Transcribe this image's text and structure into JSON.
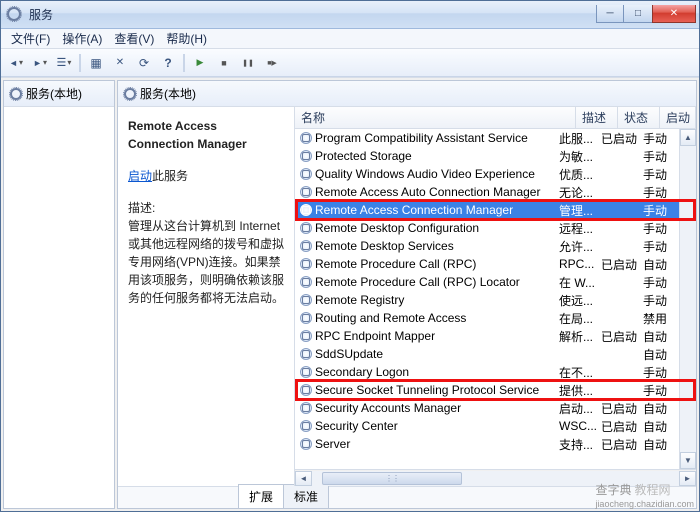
{
  "window": {
    "title": "服务"
  },
  "menu": {
    "file": "文件(F)",
    "action": "操作(A)",
    "view": "查看(V)",
    "help": "帮助(H)"
  },
  "left": {
    "header": "服务(本地)"
  },
  "right": {
    "header": "服务(本地)"
  },
  "detail": {
    "title": "Remote Access Connection Manager",
    "start_link": "启动",
    "start_suffix": "此服务",
    "desc_label": "描述:",
    "desc_text": "管理从这台计算机到 Internet 或其他远程网络的拨号和虚拟专用网络(VPN)连接。如果禁用该项服务，则明确依赖该服务的任何服务都将无法启动。"
  },
  "columns": {
    "name": "名称",
    "desc": "描述",
    "status": "状态",
    "startup": "启动"
  },
  "services": [
    {
      "name": "Program Compatibility Assistant Service",
      "desc": "此服...",
      "status": "已启动",
      "startup": "手动"
    },
    {
      "name": "Protected Storage",
      "desc": "为敏...",
      "status": "",
      "startup": "手动"
    },
    {
      "name": "Quality Windows Audio Video Experience",
      "desc": "优质...",
      "status": "",
      "startup": "手动"
    },
    {
      "name": "Remote Access Auto Connection Manager",
      "desc": "无论...",
      "status": "",
      "startup": "手动"
    },
    {
      "name": "Remote Access Connection Manager",
      "desc": "管理...",
      "status": "",
      "startup": "手动",
      "selected": true
    },
    {
      "name": "Remote Desktop Configuration",
      "desc": "远程...",
      "status": "",
      "startup": "手动"
    },
    {
      "name": "Remote Desktop Services",
      "desc": "允许...",
      "status": "",
      "startup": "手动"
    },
    {
      "name": "Remote Procedure Call (RPC)",
      "desc": "RPC...",
      "status": "已启动",
      "startup": "自动"
    },
    {
      "name": "Remote Procedure Call (RPC) Locator",
      "desc": "在 W...",
      "status": "",
      "startup": "手动"
    },
    {
      "name": "Remote Registry",
      "desc": "使远...",
      "status": "",
      "startup": "手动"
    },
    {
      "name": "Routing and Remote Access",
      "desc": "在局...",
      "status": "",
      "startup": "禁用"
    },
    {
      "name": "RPC Endpoint Mapper",
      "desc": "解析...",
      "status": "已启动",
      "startup": "自动"
    },
    {
      "name": "SddSUpdate",
      "desc": "",
      "status": "",
      "startup": "自动"
    },
    {
      "name": "Secondary Logon",
      "desc": "在不...",
      "status": "",
      "startup": "手动"
    },
    {
      "name": "Secure Socket Tunneling Protocol Service",
      "desc": "提供...",
      "status": "",
      "startup": "手动"
    },
    {
      "name": "Security Accounts Manager",
      "desc": "启动...",
      "status": "已启动",
      "startup": "自动"
    },
    {
      "name": "Security Center",
      "desc": "WSC...",
      "status": "已启动",
      "startup": "自动"
    },
    {
      "name": "Server",
      "desc": "支持...",
      "status": "已启动",
      "startup": "自动"
    }
  ],
  "tabs": {
    "extended": "扩展",
    "standard": "标准"
  },
  "watermark": {
    "a": "查字典",
    "b": "教程网",
    "url": "jiaocheng.chazidian.com"
  }
}
